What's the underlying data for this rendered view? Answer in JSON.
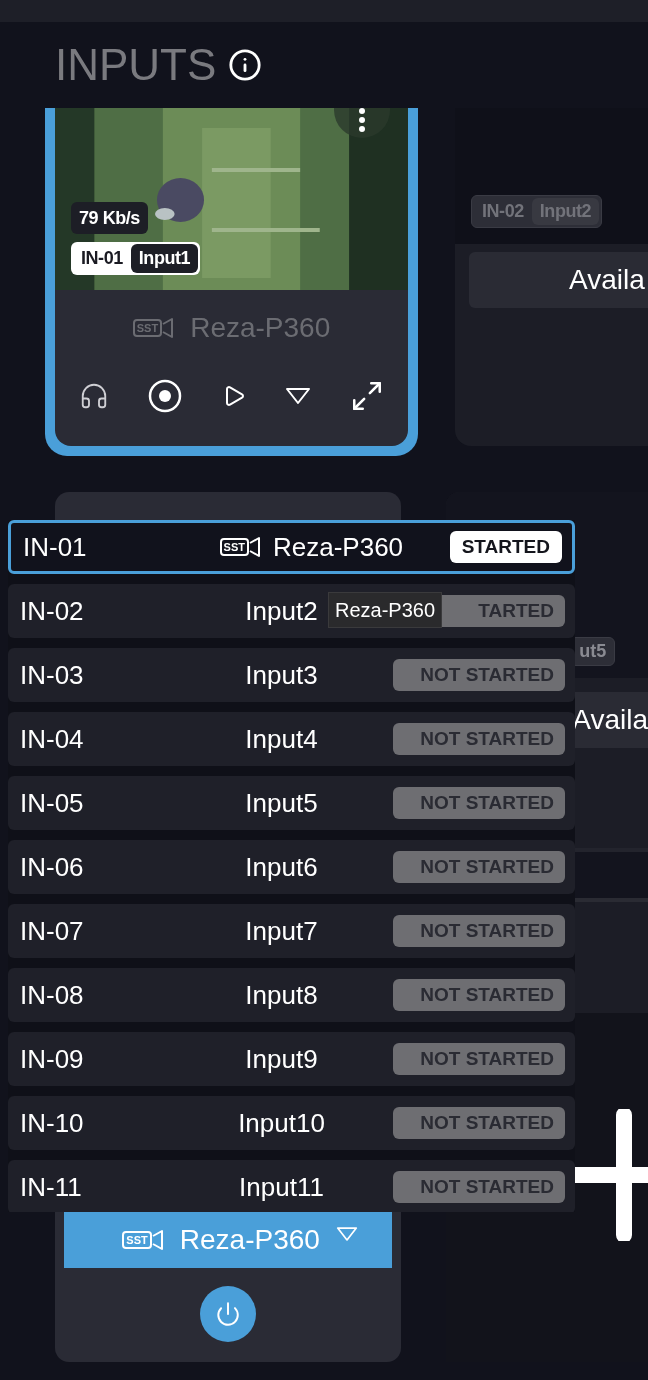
{
  "title": "INPUTS",
  "input_card": {
    "selected": true,
    "bitrate": "79 Kb/s",
    "tag": {
      "id": "IN-01",
      "name": "Input1"
    },
    "device": {
      "badge": "SST",
      "name": "Reza-P360"
    }
  },
  "side_card": {
    "tag": {
      "id": "IN-02",
      "name": "Input2"
    },
    "button": "Availa"
  },
  "source_card": {
    "device": {
      "badge": "SST",
      "name": "Reza-P360"
    }
  },
  "side_card_2": {
    "tag": "ut5",
    "button": "Availa"
  },
  "dropdown": {
    "items": [
      {
        "id": "IN-01",
        "badge": "SST",
        "name": "Reza-P360",
        "status": "STARTED",
        "started": true,
        "selected": true
      },
      {
        "id": "IN-02",
        "name": "Input2",
        "status": "TARTED",
        "started": false,
        "selected": false
      },
      {
        "id": "IN-03",
        "name": "Input3",
        "status": "NOT STARTED",
        "started": false,
        "selected": false
      },
      {
        "id": "IN-04",
        "name": "Input4",
        "status": "NOT STARTED",
        "started": false,
        "selected": false
      },
      {
        "id": "IN-05",
        "name": "Input5",
        "status": "NOT STARTED",
        "started": false,
        "selected": false
      },
      {
        "id": "IN-06",
        "name": "Input6",
        "status": "NOT STARTED",
        "started": false,
        "selected": false
      },
      {
        "id": "IN-07",
        "name": "Input7",
        "status": "NOT STARTED",
        "started": false,
        "selected": false
      },
      {
        "id": "IN-08",
        "name": "Input8",
        "status": "NOT STARTED",
        "started": false,
        "selected": false
      },
      {
        "id": "IN-09",
        "name": "Input9",
        "status": "NOT STARTED",
        "started": false,
        "selected": false
      },
      {
        "id": "IN-10",
        "name": "Input10",
        "status": "NOT STARTED",
        "started": false,
        "selected": false
      },
      {
        "id": "IN-11",
        "name": "Input11",
        "status": "NOT STARTED",
        "started": false,
        "selected": false
      }
    ]
  },
  "tooltip": "Reza-P360"
}
